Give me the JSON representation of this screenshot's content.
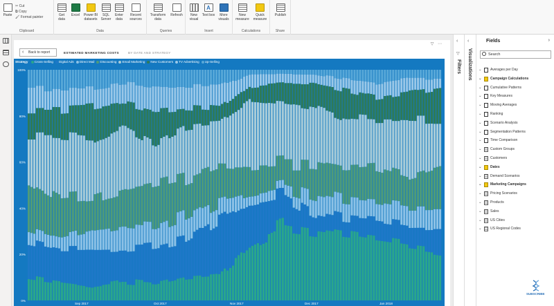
{
  "ribbon": {
    "clipboard": {
      "label": "Clipboard",
      "paste": "Paste",
      "cut": "Cut",
      "copy": "Copy",
      "format_painter": "Format painter"
    },
    "data": {
      "label": "Data",
      "buttons": [
        "Get data",
        "Excel",
        "Power BI datasets",
        "SQL Server",
        "Enter data",
        "Recent sources"
      ]
    },
    "queries": {
      "label": "Queries",
      "buttons": [
        "Transform data",
        "Refresh"
      ]
    },
    "insert": {
      "label": "Insert",
      "buttons": [
        "New visual",
        "Text box",
        "More visuals"
      ]
    },
    "calculations": {
      "label": "Calculations",
      "buttons": [
        "New measure",
        "Quick measure"
      ]
    },
    "share": {
      "label": "Share",
      "buttons": [
        "Publish"
      ]
    }
  },
  "report": {
    "back_button": "Back to report",
    "visual_title": "ESTIMATED MARKETING COSTS",
    "visual_subtitle": "BY DATE AND STRATEGY"
  },
  "panes": {
    "filters_label": "Filters",
    "visualizations_label": "Visualizations"
  },
  "fields": {
    "title": "Fields",
    "search_placeholder": "Search",
    "items": [
      {
        "name": "Averages per Day",
        "type": "calc",
        "bold": false
      },
      {
        "name": "Campaign Calculations",
        "type": "cal",
        "bold": true
      },
      {
        "name": "Cumulative Patterns",
        "type": "calc",
        "bold": false
      },
      {
        "name": "Key Measures",
        "type": "calc",
        "bold": false
      },
      {
        "name": "Moving Averages",
        "type": "calc",
        "bold": false
      },
      {
        "name": "Ranking",
        "type": "calc",
        "bold": false
      },
      {
        "name": "Scenario Analysis",
        "type": "calc",
        "bold": false
      },
      {
        "name": "Segmentation Patterns",
        "type": "calc",
        "bold": false
      },
      {
        "name": "Time Comparison",
        "type": "calc",
        "bold": false
      },
      {
        "name": "Custom Groups",
        "type": "tbl",
        "bold": false
      },
      {
        "name": "Customers",
        "type": "tbl",
        "bold": false
      },
      {
        "name": "Dates",
        "type": "cal",
        "bold": true
      },
      {
        "name": "Demand Scenarios",
        "type": "tbl",
        "bold": false
      },
      {
        "name": "Marketing Campaigns",
        "type": "cal",
        "bold": true
      },
      {
        "name": "Pricing Scenarios",
        "type": "tbl",
        "bold": false
      },
      {
        "name": "Products",
        "type": "tbl",
        "bold": false
      },
      {
        "name": "Sales",
        "type": "tbl",
        "bold": false
      },
      {
        "name": "US Cities",
        "type": "tbl",
        "bold": false
      },
      {
        "name": "US Regional Codes",
        "type": "tbl",
        "bold": false
      }
    ]
  },
  "watermark": "SUBSCRIBE",
  "chart_data": {
    "type": "bar",
    "stacking": "100%",
    "legend_title": "Strategy",
    "legend_position": "top-left",
    "x_ticks": [
      "Sep 2017",
      "Oct 2017",
      "Nov 2017",
      "Dec 2017",
      "Jan 2018"
    ],
    "y_ticks": [
      "0%",
      "20%",
      "40%",
      "60%",
      "80%",
      "100%"
    ],
    "ylim": [
      0,
      100
    ],
    "background": "#1479c1",
    "series": [
      {
        "name": "Cross-Selling",
        "color": "#2aa68c",
        "anchors": [
          10,
          8,
          6,
          8,
          7,
          10,
          11,
          25,
          32,
          30,
          28,
          26,
          24,
          22
        ]
      },
      {
        "name": "Digital Ads",
        "color": "#1e78c8",
        "anchors": [
          15,
          14,
          16,
          14,
          16,
          16,
          24,
          18,
          14,
          8,
          7,
          8,
          8,
          10
        ]
      },
      {
        "name": "Direct Mail",
        "color": "#8dc2e6",
        "anchors": [
          6,
          5,
          8,
          10,
          8,
          10,
          8,
          4,
          4,
          8,
          8,
          8,
          8,
          8
        ]
      },
      {
        "name": "Discounting",
        "color": "#4f9b79",
        "anchors": [
          20,
          16,
          14,
          16,
          20,
          18,
          16,
          12,
          10,
          14,
          14,
          16,
          14,
          18
        ]
      },
      {
        "name": "Email Marketing",
        "color": "#a8ccd8",
        "anchors": [
          20,
          28,
          26,
          28,
          18,
          22,
          18,
          28,
          26,
          24,
          22,
          20,
          24,
          20
        ]
      },
      {
        "name": "New Customers",
        "color": "#2e7a58",
        "anchors": [
          12,
          12,
          14,
          10,
          14,
          8,
          6,
          6,
          8,
          10,
          12,
          10,
          12,
          14
        ]
      },
      {
        "name": "TV Advertising",
        "color": "#9ac8e8",
        "anchors": [
          9,
          9,
          8,
          8,
          10,
          9,
          10,
          5,
          4,
          4,
          5,
          6,
          6,
          4
        ]
      },
      {
        "name": "Up-Selling",
        "color": "#58a8d8",
        "anchors": [
          8,
          8,
          8,
          6,
          7,
          7,
          7,
          2,
          2,
          2,
          4,
          6,
          4,
          4
        ]
      }
    ]
  }
}
